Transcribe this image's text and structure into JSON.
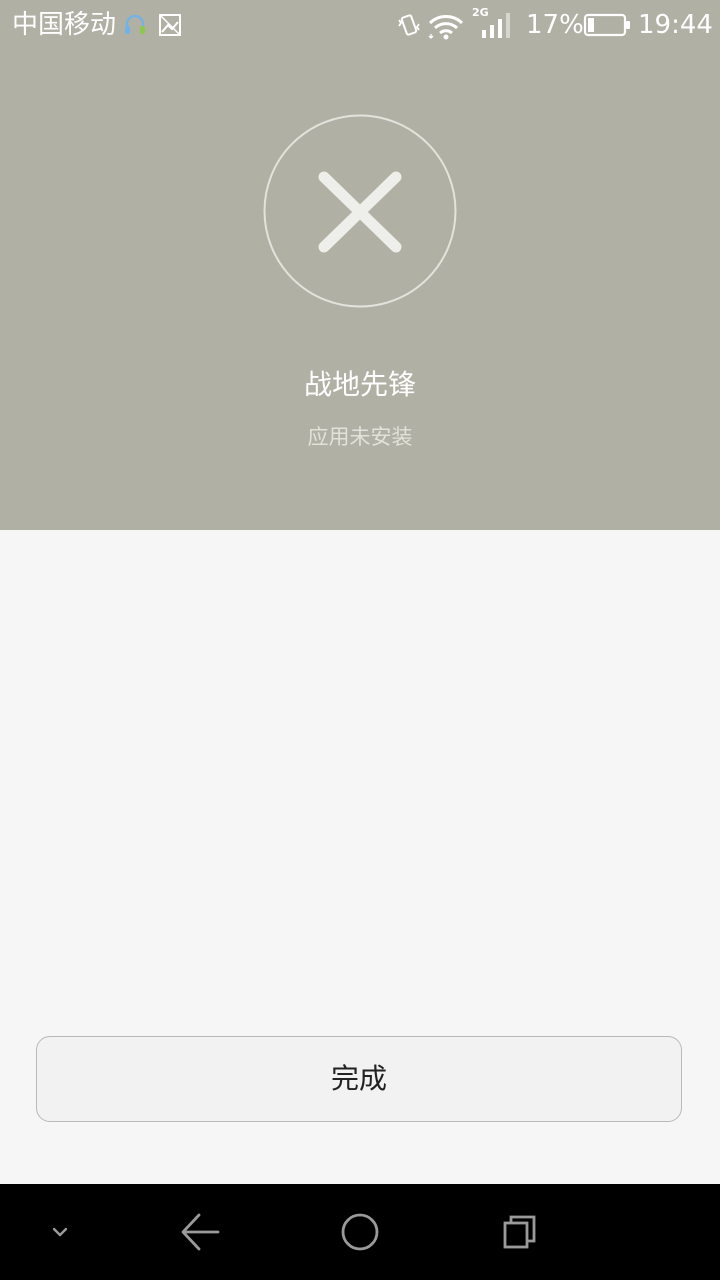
{
  "status_bar": {
    "carrier": "中国移动",
    "network_type": "2G",
    "battery_percent": "17%",
    "battery_level": 0.17,
    "time": "19:44",
    "icons": [
      "headset-notification-icon",
      "image-notification-icon",
      "vibrate-icon",
      "wifi-icon",
      "signal-icon",
      "battery-icon"
    ]
  },
  "result": {
    "icon": "close-icon",
    "app_name": "战地先锋",
    "status": "应用未安装"
  },
  "actions": {
    "done_label": "完成"
  },
  "nav_bar": {
    "icons": [
      "hide-nav-icon",
      "back-icon",
      "home-icon",
      "recents-icon"
    ]
  },
  "colors": {
    "hero_background": "#b0b0a5",
    "page_background": "#f6f6f6",
    "nav_background": "#000000"
  }
}
